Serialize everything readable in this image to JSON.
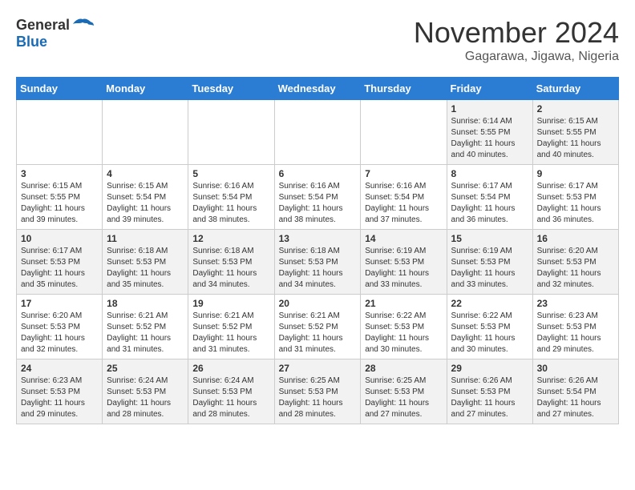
{
  "header": {
    "logo_general": "General",
    "logo_blue": "Blue",
    "month_title": "November 2024",
    "location": "Gagarawa, Jigawa, Nigeria"
  },
  "weekdays": [
    "Sunday",
    "Monday",
    "Tuesday",
    "Wednesday",
    "Thursday",
    "Friday",
    "Saturday"
  ],
  "weeks": [
    [
      {
        "day": "",
        "info": ""
      },
      {
        "day": "",
        "info": ""
      },
      {
        "day": "",
        "info": ""
      },
      {
        "day": "",
        "info": ""
      },
      {
        "day": "",
        "info": ""
      },
      {
        "day": "1",
        "info": "Sunrise: 6:14 AM\nSunset: 5:55 PM\nDaylight: 11 hours\nand 40 minutes."
      },
      {
        "day": "2",
        "info": "Sunrise: 6:15 AM\nSunset: 5:55 PM\nDaylight: 11 hours\nand 40 minutes."
      }
    ],
    [
      {
        "day": "3",
        "info": "Sunrise: 6:15 AM\nSunset: 5:55 PM\nDaylight: 11 hours\nand 39 minutes."
      },
      {
        "day": "4",
        "info": "Sunrise: 6:15 AM\nSunset: 5:54 PM\nDaylight: 11 hours\nand 39 minutes."
      },
      {
        "day": "5",
        "info": "Sunrise: 6:16 AM\nSunset: 5:54 PM\nDaylight: 11 hours\nand 38 minutes."
      },
      {
        "day": "6",
        "info": "Sunrise: 6:16 AM\nSunset: 5:54 PM\nDaylight: 11 hours\nand 38 minutes."
      },
      {
        "day": "7",
        "info": "Sunrise: 6:16 AM\nSunset: 5:54 PM\nDaylight: 11 hours\nand 37 minutes."
      },
      {
        "day": "8",
        "info": "Sunrise: 6:17 AM\nSunset: 5:54 PM\nDaylight: 11 hours\nand 36 minutes."
      },
      {
        "day": "9",
        "info": "Sunrise: 6:17 AM\nSunset: 5:53 PM\nDaylight: 11 hours\nand 36 minutes."
      }
    ],
    [
      {
        "day": "10",
        "info": "Sunrise: 6:17 AM\nSunset: 5:53 PM\nDaylight: 11 hours\nand 35 minutes."
      },
      {
        "day": "11",
        "info": "Sunrise: 6:18 AM\nSunset: 5:53 PM\nDaylight: 11 hours\nand 35 minutes."
      },
      {
        "day": "12",
        "info": "Sunrise: 6:18 AM\nSunset: 5:53 PM\nDaylight: 11 hours\nand 34 minutes."
      },
      {
        "day": "13",
        "info": "Sunrise: 6:18 AM\nSunset: 5:53 PM\nDaylight: 11 hours\nand 34 minutes."
      },
      {
        "day": "14",
        "info": "Sunrise: 6:19 AM\nSunset: 5:53 PM\nDaylight: 11 hours\nand 33 minutes."
      },
      {
        "day": "15",
        "info": "Sunrise: 6:19 AM\nSunset: 5:53 PM\nDaylight: 11 hours\nand 33 minutes."
      },
      {
        "day": "16",
        "info": "Sunrise: 6:20 AM\nSunset: 5:53 PM\nDaylight: 11 hours\nand 32 minutes."
      }
    ],
    [
      {
        "day": "17",
        "info": "Sunrise: 6:20 AM\nSunset: 5:53 PM\nDaylight: 11 hours\nand 32 minutes."
      },
      {
        "day": "18",
        "info": "Sunrise: 6:21 AM\nSunset: 5:52 PM\nDaylight: 11 hours\nand 31 minutes."
      },
      {
        "day": "19",
        "info": "Sunrise: 6:21 AM\nSunset: 5:52 PM\nDaylight: 11 hours\nand 31 minutes."
      },
      {
        "day": "20",
        "info": "Sunrise: 6:21 AM\nSunset: 5:52 PM\nDaylight: 11 hours\nand 31 minutes."
      },
      {
        "day": "21",
        "info": "Sunrise: 6:22 AM\nSunset: 5:53 PM\nDaylight: 11 hours\nand 30 minutes."
      },
      {
        "day": "22",
        "info": "Sunrise: 6:22 AM\nSunset: 5:53 PM\nDaylight: 11 hours\nand 30 minutes."
      },
      {
        "day": "23",
        "info": "Sunrise: 6:23 AM\nSunset: 5:53 PM\nDaylight: 11 hours\nand 29 minutes."
      }
    ],
    [
      {
        "day": "24",
        "info": "Sunrise: 6:23 AM\nSunset: 5:53 PM\nDaylight: 11 hours\nand 29 minutes."
      },
      {
        "day": "25",
        "info": "Sunrise: 6:24 AM\nSunset: 5:53 PM\nDaylight: 11 hours\nand 28 minutes."
      },
      {
        "day": "26",
        "info": "Sunrise: 6:24 AM\nSunset: 5:53 PM\nDaylight: 11 hours\nand 28 minutes."
      },
      {
        "day": "27",
        "info": "Sunrise: 6:25 AM\nSunset: 5:53 PM\nDaylight: 11 hours\nand 28 minutes."
      },
      {
        "day": "28",
        "info": "Sunrise: 6:25 AM\nSunset: 5:53 PM\nDaylight: 11 hours\nand 27 minutes."
      },
      {
        "day": "29",
        "info": "Sunrise: 6:26 AM\nSunset: 5:53 PM\nDaylight: 11 hours\nand 27 minutes."
      },
      {
        "day": "30",
        "info": "Sunrise: 6:26 AM\nSunset: 5:54 PM\nDaylight: 11 hours\nand 27 minutes."
      }
    ]
  ]
}
